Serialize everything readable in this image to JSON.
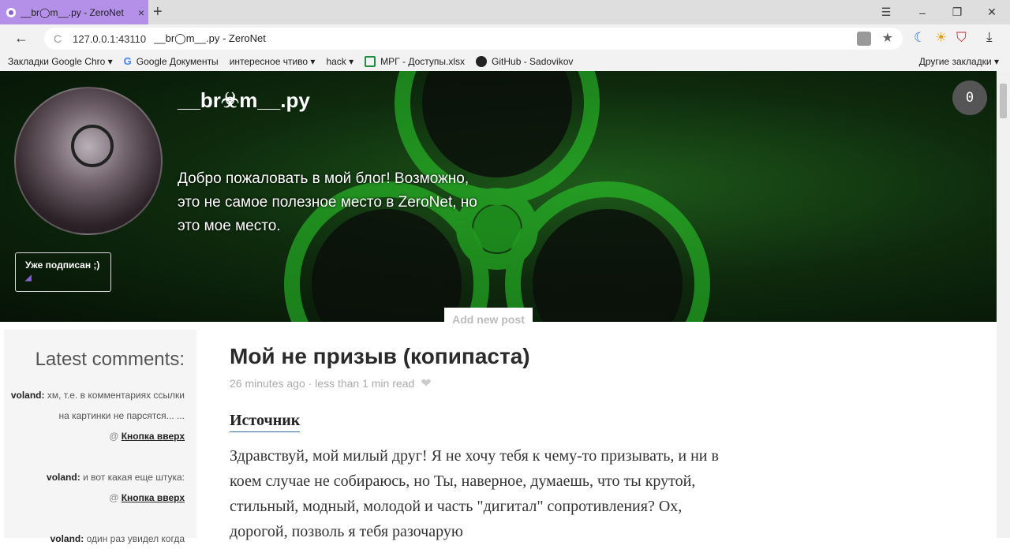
{
  "browser": {
    "tab_title": "__br◯m__.py - ZeroNet",
    "tab_close": "×",
    "new_tab": "+",
    "win_menu": "☰",
    "win_minimize": "–",
    "win_restore": "❐",
    "win_close": "✕",
    "back": "←",
    "reload": "C",
    "url_host": "127.0.0.1:43110",
    "url_title": "__br◯m__.py - ZeroNet",
    "download": "⤓",
    "bookmarks": [
      {
        "label": "Закладки Google Chro ▾"
      },
      {
        "label": "Google Документы"
      },
      {
        "label": "интересное чтиво ▾"
      },
      {
        "label": "hack ▾"
      },
      {
        "label": "МРГ - Доступы.xlsx"
      },
      {
        "label": "GitHub - Sadovikov"
      }
    ],
    "other_bookmarks": "Другие закладки ▾"
  },
  "header": {
    "site_title": "__br☣m__.py",
    "welcome_text": "Добро пожаловать в мой блог! Возможно, это не самое полезное место в ZeroNet, но это мое место.",
    "subscribe_label": "Уже подписан ;)",
    "rss_icon": "rss-icon",
    "counter": "0",
    "add_post": "Add new post"
  },
  "sidebar": {
    "title": "Latest comments:",
    "comments": [
      {
        "user": "voland:",
        "text": "хм, т.е. в комментариях ссылки на картинки не парсятся... ...",
        "at": "@",
        "link": "Кнопка вверх"
      },
      {
        "user": "voland:",
        "text": "и вот какая еще штука:",
        "at": "@",
        "link": "Кнопка вверх"
      },
      {
        "user": "voland:",
        "text": "один раз увидел когда"
      }
    ]
  },
  "post": {
    "title": "Мой не призыв (копипаста)",
    "meta": "26 minutes ago · less than 1 min read",
    "source": "Источник",
    "body": "Здравствуй, мой милый друг! Я не хочу тебя к чему-то призывать, и ни в коем случае не собираюсь, но Ты, наверное, думаешь, что ты крутой, стильный, модный, молодой и часть \"дигитал\" сопротивления? Ох, дорогой, позволь я тебя разочарую"
  }
}
